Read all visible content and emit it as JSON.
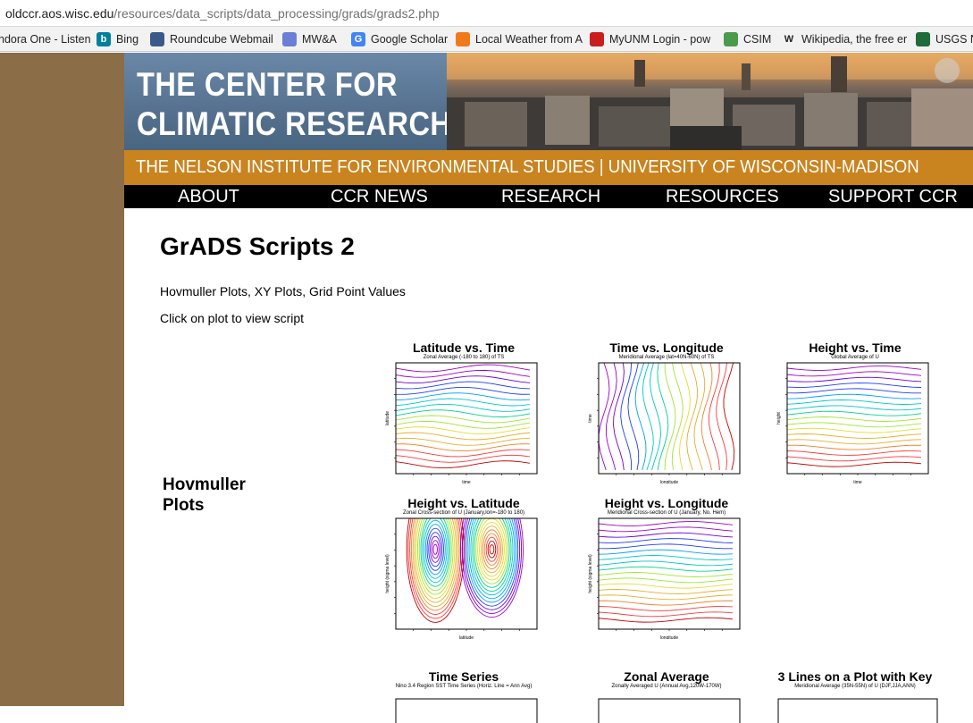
{
  "browser": {
    "url_host": "oldccr.aos.wisc.edu",
    "url_path": "/resources/data_scripts/data_processing/grads/grads2.php",
    "bookmarks": [
      {
        "label": "ndora One - Listen",
        "icon": "pandora-icon"
      },
      {
        "label": "Bing",
        "icon": "bing-icon",
        "glyph": "b"
      },
      {
        "label": "Roundcube Webmail",
        "icon": "roundcube-icon"
      },
      {
        "label": "MW&A",
        "icon": "mwa-icon"
      },
      {
        "label": "Google Scholar",
        "icon": "google-scholar-icon",
        "glyph": "G"
      },
      {
        "label": "Local Weather from A",
        "icon": "weather-icon"
      },
      {
        "label": "MyUNM Login - pow",
        "icon": "unm-icon"
      },
      {
        "label": "CSIM",
        "icon": "csim-icon"
      },
      {
        "label": "Wikipedia, the free er",
        "icon": "wikipedia-icon",
        "glyph": "W"
      },
      {
        "label": "USGS N",
        "icon": "usgs-icon"
      }
    ]
  },
  "site": {
    "banner_line1": "THE CENTER FOR",
    "banner_line2": "CLIMATIC RESEARCH",
    "subtitle": "THE NELSON INSTITUTE FOR ENVIRONMENTAL STUDIES | UNIVERSITY OF WISCONSIN-MADISON",
    "nav": [
      "ABOUT",
      "CCR NEWS",
      "RESEARCH",
      "RESOURCES",
      "SUPPORT CCR"
    ]
  },
  "page": {
    "title": "GrADS Scripts 2",
    "description": "Hovmuller Plots, XY Plots, Grid Point Values",
    "instruction": "Click on plot to view script",
    "section_label_line1": "Hovmuller",
    "section_label_line2": "Plots"
  },
  "plots": [
    {
      "title": "Latitude vs. Time",
      "subtitle": "Zonal Average (-180 to 180) of TS",
      "xlabel": "time",
      "ylabel": "latitude",
      "style": "lat-time"
    },
    {
      "title": "Time vs. Longitude",
      "subtitle": "Meridional Average (lat=40N-60N) of TS",
      "xlabel": "longitude",
      "ylabel": "time",
      "style": "time-lon"
    },
    {
      "title": "Height vs. Time",
      "subtitle": "Global Average of U",
      "xlabel": "time",
      "ylabel": "height",
      "style": "height-time"
    },
    {
      "title": "Height vs. Latitude",
      "subtitle": "Zonal Cross-section of U (January,lon=-180 to 180)",
      "xlabel": "latitude",
      "ylabel": "height (sigma level)",
      "style": "height-lat"
    },
    {
      "title": "Height vs. Longitude",
      "subtitle": "Meridional Cross-section of U (January, No. Hem)",
      "xlabel": "longitude",
      "ylabel": "height (sigma level)",
      "style": "height-lon"
    },
    {
      "title": "Time Series",
      "subtitle": "Nino 3.4 Region SST Time Series (Horiz. Line = Ann Avg)",
      "xlabel": "",
      "ylabel": "",
      "style": "partial"
    },
    {
      "title": "Zonal Average",
      "subtitle": "Zonally Averaged U (Annual Avg,120W-170W)",
      "xlabel": "",
      "ylabel": "",
      "style": "partial"
    },
    {
      "title": "3 Lines on a Plot with Key",
      "subtitle": "Meridional Average (35N-55N) of U (DJF,JJA,ANN)",
      "xlabel": "",
      "ylabel": "",
      "style": "partial"
    }
  ],
  "colors": {
    "sidebar": "#8b6d47",
    "orange_bar": "#c98420",
    "nav_bg": "#000000",
    "banner_blue": "#5a7694",
    "contour_palette": [
      "#a000c8",
      "#6e00dc",
      "#1e3cff",
      "#00a0ff",
      "#00c8c8",
      "#00d28c",
      "#a0e632",
      "#e6dc32",
      "#e6af2d",
      "#f08228",
      "#fa3c3c",
      "#c80000"
    ]
  }
}
